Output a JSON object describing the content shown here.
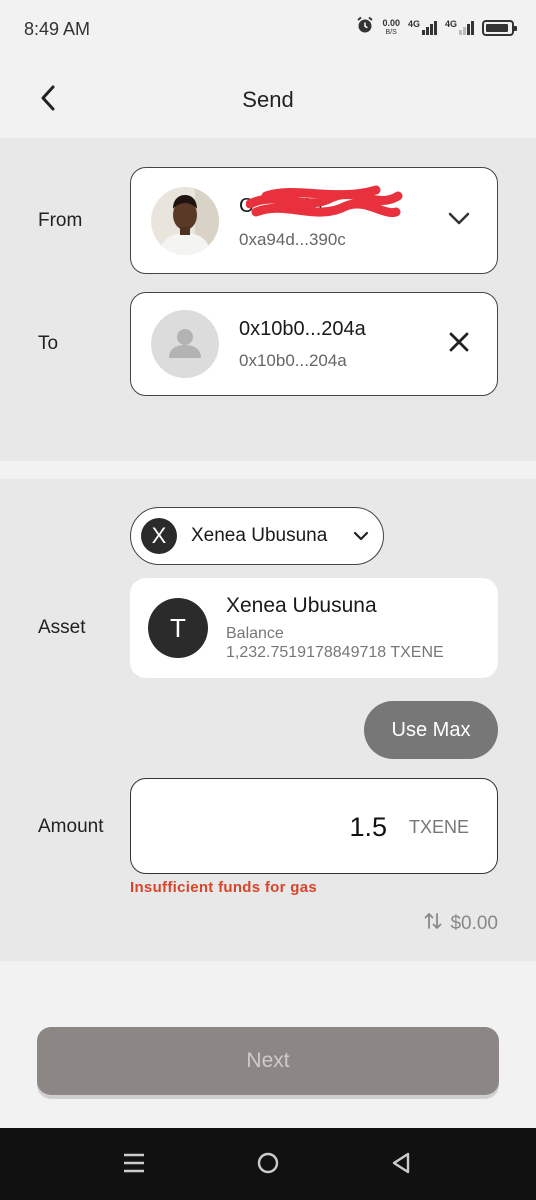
{
  "status_bar": {
    "time": "8:49 AM",
    "net_speed_value": "0.00",
    "net_speed_unit": "B/S",
    "signal1_label": "4G",
    "signal2_label": "4G",
    "battery_level": 0.9
  },
  "header": {
    "title": "Send",
    "back_icon": "chevron-left-icon"
  },
  "from": {
    "label": "From",
    "account_name": "C            24...",
    "address": "0xa94d...390c",
    "action_icon": "chevron-down-icon"
  },
  "to": {
    "label": "To",
    "account_name": "0x10b0...204a",
    "address": "0x10b0...204a",
    "action_icon": "close-icon"
  },
  "asset": {
    "label": "Asset",
    "selector_letter": "X",
    "selector_name": "Xenea Ubusuna",
    "card_letter": "T",
    "card_name": "Xenea Ubusuna",
    "balance_label": "Balance",
    "balance_value": "1,232.7519178849718 TXENE",
    "use_max_label": "Use Max"
  },
  "amount": {
    "label": "Amount",
    "value": "1.5",
    "unit": "TXENE",
    "error": "Insufficient funds for gas",
    "fiat_value": "$0.00"
  },
  "footer": {
    "next_label": "Next"
  },
  "colors": {
    "accent_dark": "#2b2b2b",
    "error": "#d9452b",
    "button_disabled": "#8c8785",
    "redaction": "#e8313d"
  }
}
